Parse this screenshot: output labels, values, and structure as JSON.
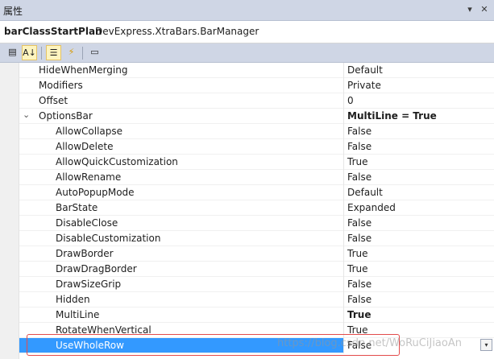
{
  "window": {
    "title": "属性",
    "pin_glyph": "▾",
    "close_glyph": "✕"
  },
  "object_selector": {
    "name": "barClassStartPlan",
    "type": "DevExpress.XtraBars.BarManager"
  },
  "toolbar": {
    "buttons": [
      {
        "name": "categorized-button",
        "icon": "categorized-icon",
        "glyph": "▤",
        "pressed": false
      },
      {
        "name": "alphabetical-button",
        "icon": "az-sort-icon",
        "glyph": "A↓",
        "pressed": true
      },
      {
        "name": "properties-button",
        "icon": "properties-icon",
        "glyph": "☰",
        "pressed": true
      },
      {
        "name": "events-button",
        "icon": "lightning-icon",
        "glyph": "⚡",
        "pressed": false
      },
      {
        "name": "property-pages-button",
        "icon": "property-pages-icon",
        "glyph": "▭",
        "pressed": false
      }
    ]
  },
  "properties": [
    {
      "name": "HideWhenMerging",
      "value": "Default"
    },
    {
      "name": "Modifiers",
      "value": "Private"
    },
    {
      "name": "Offset",
      "value": "0"
    },
    {
      "name": "OptionsBar",
      "value": "MultiLine = True",
      "expanded": true,
      "expander": "⌄",
      "bold_value": true
    },
    {
      "name": "AllowCollapse",
      "value": "False",
      "child": true
    },
    {
      "name": "AllowDelete",
      "value": "False",
      "child": true
    },
    {
      "name": "AllowQuickCustomization",
      "value": "True",
      "child": true
    },
    {
      "name": "AllowRename",
      "value": "False",
      "child": true
    },
    {
      "name": "AutoPopupMode",
      "value": "Default",
      "child": true
    },
    {
      "name": "BarState",
      "value": "Expanded",
      "child": true
    },
    {
      "name": "DisableClose",
      "value": "False",
      "child": true
    },
    {
      "name": "DisableCustomization",
      "value": "False",
      "child": true
    },
    {
      "name": "DrawBorder",
      "value": "True",
      "child": true
    },
    {
      "name": "DrawDragBorder",
      "value": "True",
      "child": true
    },
    {
      "name": "DrawSizeGrip",
      "value": "False",
      "child": true
    },
    {
      "name": "Hidden",
      "value": "False",
      "child": true
    },
    {
      "name": "MultiLine",
      "value": "True",
      "child": true,
      "bold_value": true
    },
    {
      "name": "RotateWhenVertical",
      "value": "True",
      "child": true
    },
    {
      "name": "UseWholeRow",
      "value": "False",
      "child": true,
      "selected": true,
      "dropdown_glyph": "▾"
    }
  ],
  "watermark": "https://blog.csdn.net/WoRuCiJiaoAn",
  "colors": {
    "selection": "#3399ff",
    "highlight_box": "#e34b4b",
    "toolbar_bg": "#cfd6e5"
  }
}
